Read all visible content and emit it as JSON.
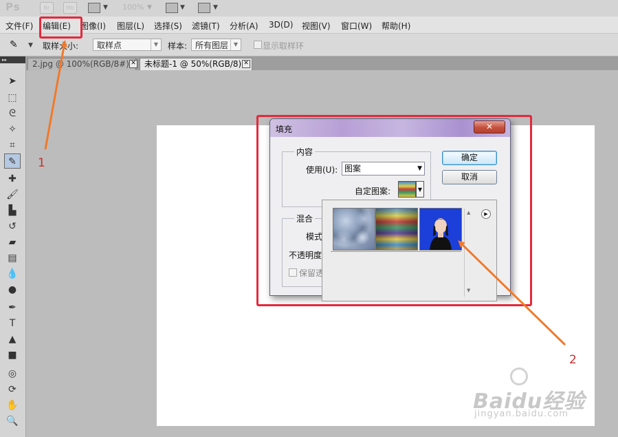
{
  "app": {
    "logo": "Ps",
    "badges": [
      "Br",
      "Mb"
    ],
    "zoom": "100%"
  },
  "menu": [
    {
      "label": "文件(F)"
    },
    {
      "label": "编辑(E)"
    },
    {
      "label": "图像(I)"
    },
    {
      "label": "图层(L)"
    },
    {
      "label": "选择(S)"
    },
    {
      "label": "滤镜(T)"
    },
    {
      "label": "分析(A)"
    },
    {
      "label": "3D(D)"
    },
    {
      "label": "视图(V)"
    },
    {
      "label": "窗口(W)"
    },
    {
      "label": "帮助(H)"
    }
  ],
  "options_bar": {
    "sample_size_label": "取样大小:",
    "sample_size_value": "取样点",
    "sample_label": "样本:",
    "sample_value": "所有图层",
    "show_ring_label": "显示取样环"
  },
  "tabs": [
    {
      "label": "2.jpg @ 100%(RGB/8#) *"
    },
    {
      "label": "未标题-1 @ 50%(RGB/8)"
    }
  ],
  "dialog": {
    "title": "填充",
    "close": "✕",
    "content_group": "内容",
    "use_label": "使用(U):",
    "use_value": "图案",
    "custom_pattern_label": "自定图案:",
    "blend_group": "混合",
    "mode_label": "模式",
    "opacity_label": "不透明度",
    "preserve_label": "保留透",
    "ok": "确定",
    "cancel": "取消"
  },
  "annotations": {
    "step1": "1",
    "step2": "2",
    "highlight_color": "#e6283a",
    "arrow_color": "#f07a2b"
  },
  "watermark": {
    "brand": "Baidu经验",
    "url": "jingyan.baidu.com"
  }
}
